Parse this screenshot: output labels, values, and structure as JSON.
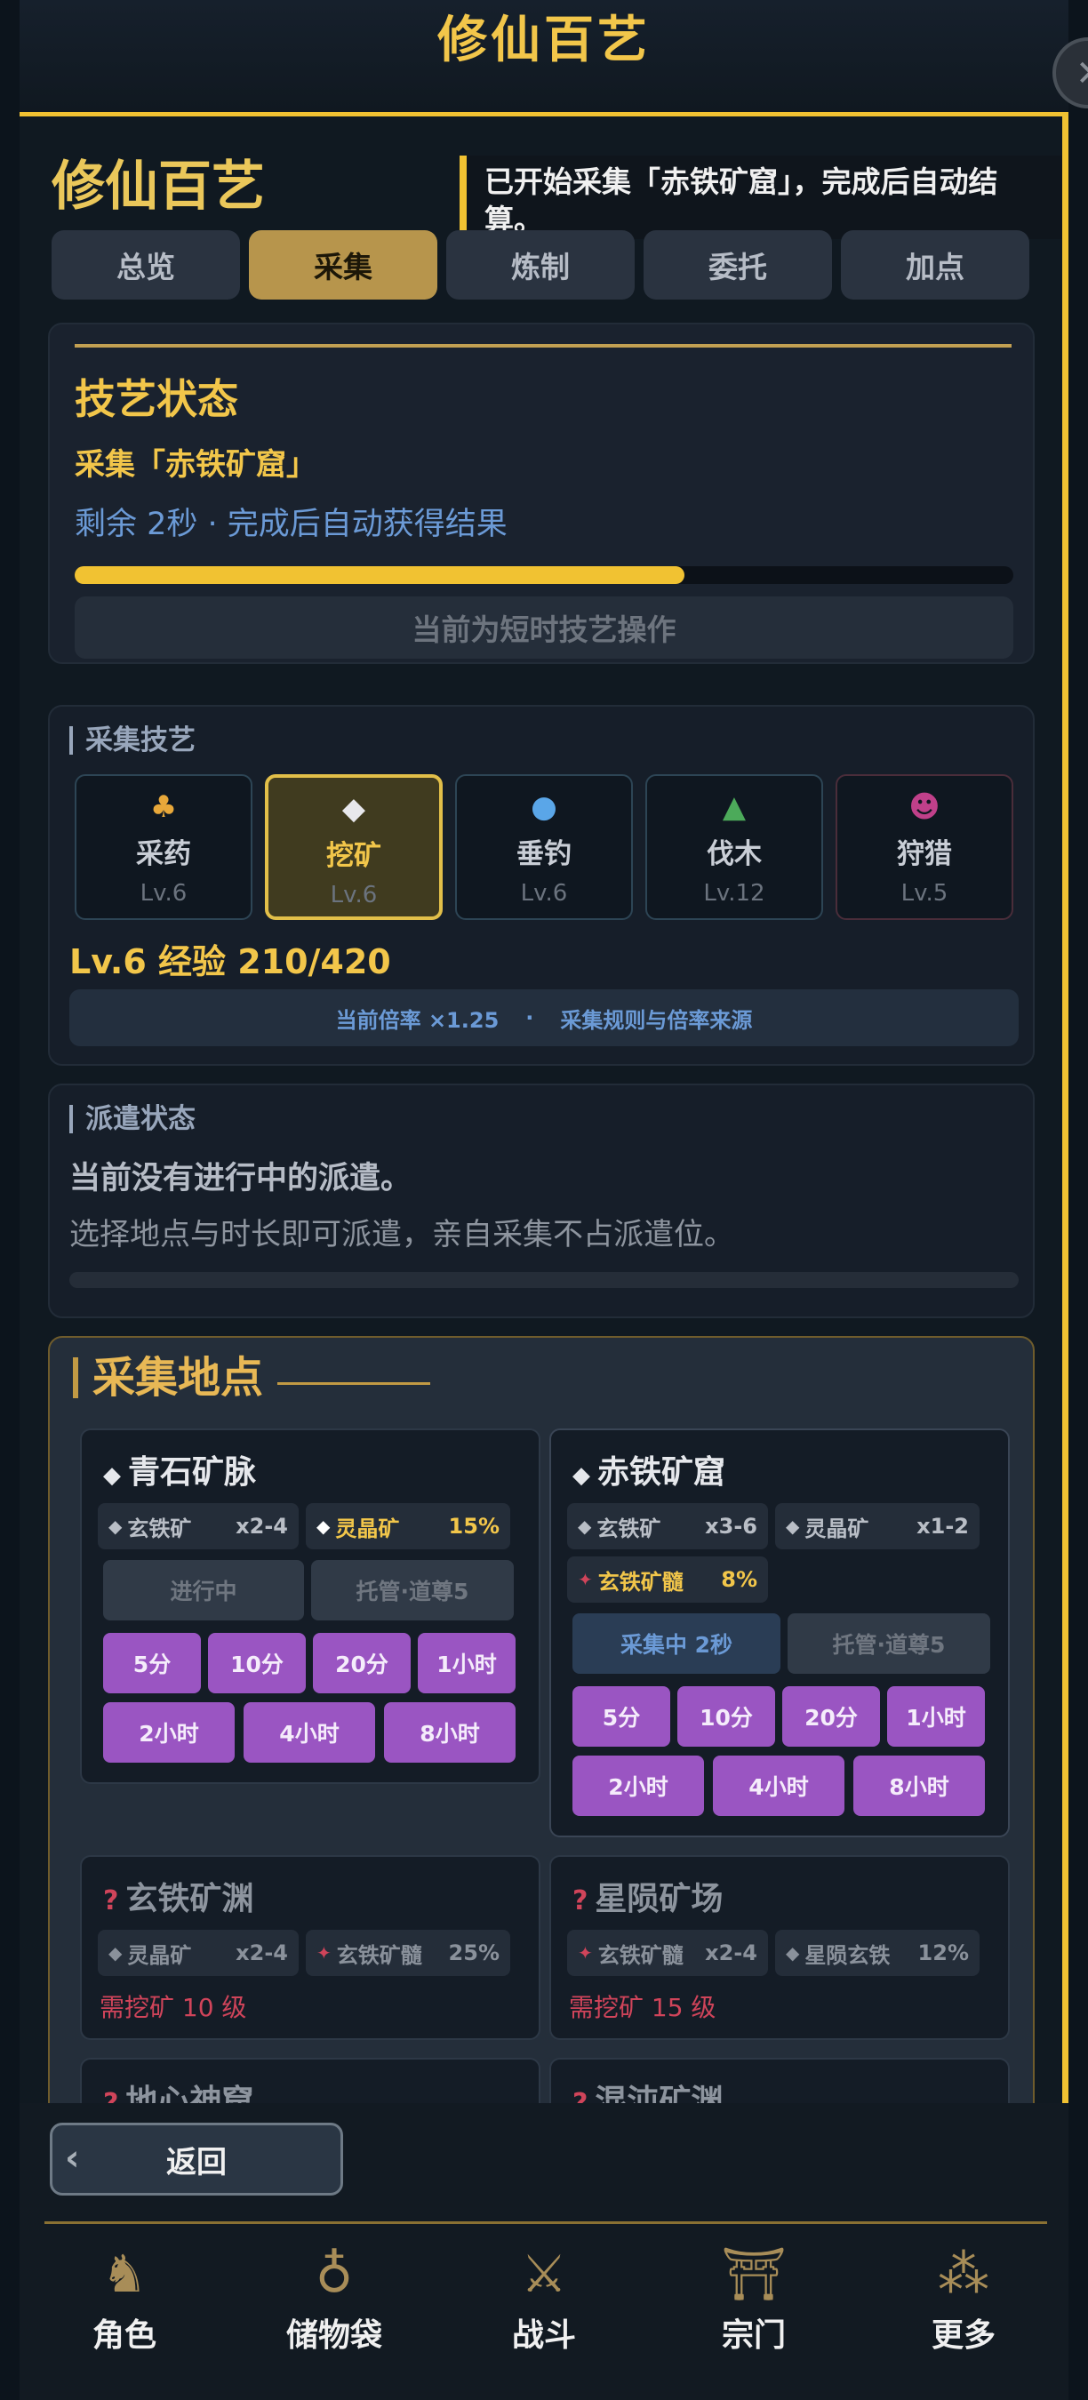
{
  "top_title": "修仙百艺",
  "heading": "修仙百艺",
  "toast": "已开始采集「赤铁矿窟」，完成后自动结算。",
  "tabs": [
    "总览",
    "采集",
    "炼制",
    "委托",
    "加点"
  ],
  "status": {
    "title": "技艺状态",
    "name": "采集「赤铁矿窟」",
    "remain": "剩余 2秒 · 完成后自动获得结果",
    "progress": 0.65,
    "op_label": "当前为短时技艺操作"
  },
  "skills": {
    "label": "采集技艺",
    "items": [
      {
        "name": "采药",
        "level": "Lv.6",
        "icon": "herb-icon"
      },
      {
        "name": "挖矿",
        "level": "Lv.6",
        "icon": "ore-icon"
      },
      {
        "name": "垂钓",
        "level": "Lv.6",
        "icon": "water-drop-icon"
      },
      {
        "name": "伐木",
        "level": "Lv.12",
        "icon": "tree-icon"
      },
      {
        "name": "狩猎",
        "level": "Lv.5",
        "icon": "demon-icon"
      }
    ],
    "level_line": "Lv.6  经验 210/420",
    "rate": "当前倍率 ×1.25",
    "rate_sep": "·",
    "rate_link": "采集规则与倍率来源"
  },
  "dispatch": {
    "label": "派遣状态",
    "none": "当前没有进行中的派遣。",
    "hint": "选择地点与时长即可派遣，亲自采集不占派遣位。"
  },
  "locations": {
    "title": "采集地点",
    "loc1": {
      "name": "青石矿脉",
      "drops": [
        {
          "name": "玄铁矿",
          "value": "x2-4"
        },
        {
          "name": "灵晶矿",
          "value": "15%"
        }
      ],
      "status": "进行中",
      "delegate": "托管·道尊5",
      "durations": [
        "5分",
        "10分",
        "20分",
        "1小时",
        "2小时",
        "4小时",
        "8小时"
      ]
    },
    "loc2": {
      "name": "赤铁矿窟",
      "drops": [
        {
          "name": "玄铁矿",
          "value": "x3-6"
        },
        {
          "name": "灵晶矿",
          "value": "x1-2"
        },
        {
          "name": "玄铁矿髓",
          "value": "8%"
        }
      ],
      "status": "采集中 2秒",
      "delegate": "托管·道尊5",
      "durations": [
        "5分",
        "10分",
        "20分",
        "1小时",
        "2小时",
        "4小时",
        "8小时"
      ]
    },
    "loc3": {
      "name": "玄铁矿渊",
      "drops": [
        {
          "name": "灵晶矿",
          "value": "x2-4"
        },
        {
          "name": "玄铁矿髓",
          "value": "25%"
        }
      ],
      "req": "需挖矿 10 级"
    },
    "loc4": {
      "name": "星陨矿场",
      "drops": [
        {
          "name": "玄铁矿髓",
          "value": "x2-4"
        },
        {
          "name": "星陨玄铁",
          "value": "12%"
        }
      ],
      "req": "需挖矿 15 级"
    },
    "loc5": {
      "name": "地心神窟"
    },
    "loc6": {
      "name": "混沌矿渊"
    }
  },
  "back": "返回",
  "nav": [
    {
      "label": "角色",
      "icon": "character-icon"
    },
    {
      "label": "储物袋",
      "icon": "bag-icon"
    },
    {
      "label": "战斗",
      "icon": "swords-icon"
    },
    {
      "label": "宗门",
      "icon": "sect-gate-icon"
    },
    {
      "label": "更多",
      "icon": "more-icon"
    }
  ],
  "colors": {
    "accent": "#f1c232",
    "purple": "#9a55c2",
    "danger": "#d0445a",
    "link": "#6b9ad6"
  }
}
